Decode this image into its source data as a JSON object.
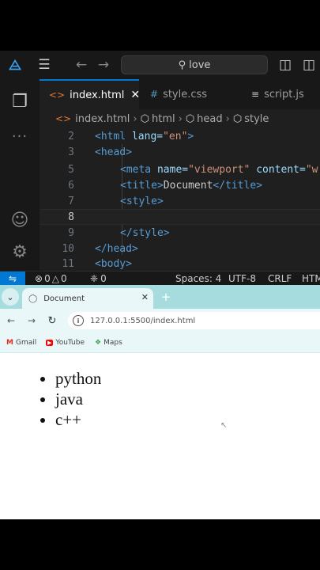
{
  "vscode": {
    "title_bar": {
      "search_text": "love"
    },
    "tabs": [
      {
        "label": "index.html",
        "icon": "html-file-icon",
        "active": true
      },
      {
        "label": "style.css",
        "icon": "css-file-icon",
        "active": false
      },
      {
        "label": "script.js",
        "icon": "js-file-icon",
        "active": false
      }
    ],
    "breadcrumb": [
      "index.html",
      "html",
      "head",
      "style"
    ],
    "code": {
      "lines": [
        {
          "num": "2",
          "parts": [
            "<html",
            " lang=",
            "\"en\"",
            ">"
          ]
        },
        {
          "num": "3",
          "parts": [
            "<head",
            ">"
          ]
        },
        {
          "num": "5",
          "parts": [
            "<meta",
            " name=",
            "\"viewport\"",
            " content=",
            "\"w"
          ]
        },
        {
          "num": "6",
          "parts": [
            "<title>",
            "Document",
            "</title>"
          ]
        },
        {
          "num": "7",
          "parts": [
            "<style>"
          ]
        },
        {
          "num": "8",
          "parts": []
        },
        {
          "num": "9",
          "parts": [
            "</style>"
          ]
        },
        {
          "num": "10",
          "parts": [
            "</head>"
          ]
        },
        {
          "num": "11",
          "parts": [
            "<body>"
          ]
        }
      ],
      "active_line": "8"
    },
    "status_bar": {
      "errors": "0",
      "warnings": "0",
      "ports": "0",
      "spaces": "Spaces: 4",
      "encoding": "UTF-8",
      "eol": "CRLF",
      "language": "HTML"
    }
  },
  "browser": {
    "tab_title": "Document",
    "url": "127.0.0.1:5500/index.html",
    "bookmarks": [
      {
        "label": "Gmail",
        "icon": "gmail-icon"
      },
      {
        "label": "YouTube",
        "icon": "youtube-icon"
      },
      {
        "label": "Maps",
        "icon": "maps-icon"
      }
    ],
    "list_items": [
      "python",
      "java",
      "c++"
    ]
  },
  "colors": {
    "vscode_bg": "#1f1f1f",
    "accent": "#0078d4",
    "browser_frame": "#a7dcdf",
    "tag": "#569cd6",
    "attr": "#9cdcfe",
    "string": "#ce9178"
  }
}
